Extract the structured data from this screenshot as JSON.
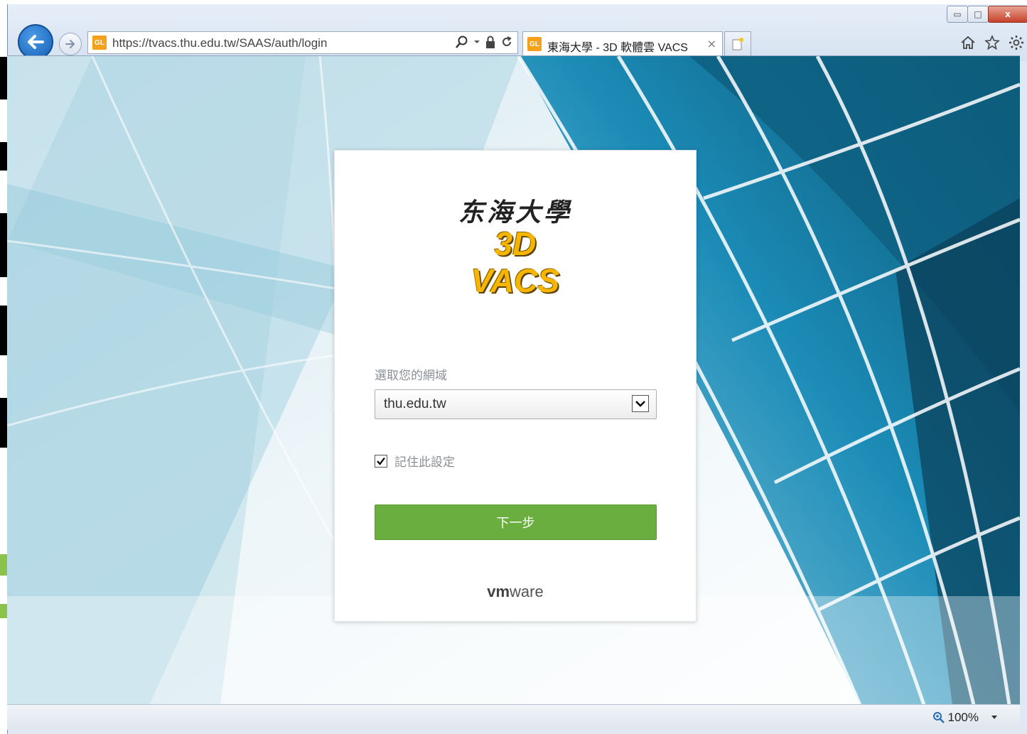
{
  "browser": {
    "url": "https://tvacs.thu.edu.tw/SAAS/auth/login",
    "tab_title": "東海大學 - 3D 軟體雲 VACS",
    "favicon_text": "GL",
    "tab_close": "×",
    "zoom": "100%",
    "window_controls": {
      "minimize": "▭",
      "maximize": "□",
      "close": "x"
    }
  },
  "login": {
    "logo_cn": "东海大學",
    "logo_3d": "3D",
    "logo_vacs": "VACS",
    "domain_label": "選取您的網域",
    "domain_value": "thu.edu.tw",
    "remember_label": "記住此設定",
    "remember_checked": true,
    "next_label": "下一步",
    "brand": {
      "vm": "vm",
      "ware": "ware"
    }
  },
  "colors": {
    "button_green": "#6aae3f",
    "logo_gold": "#f7b500",
    "ie_blue": "#1660b8"
  }
}
